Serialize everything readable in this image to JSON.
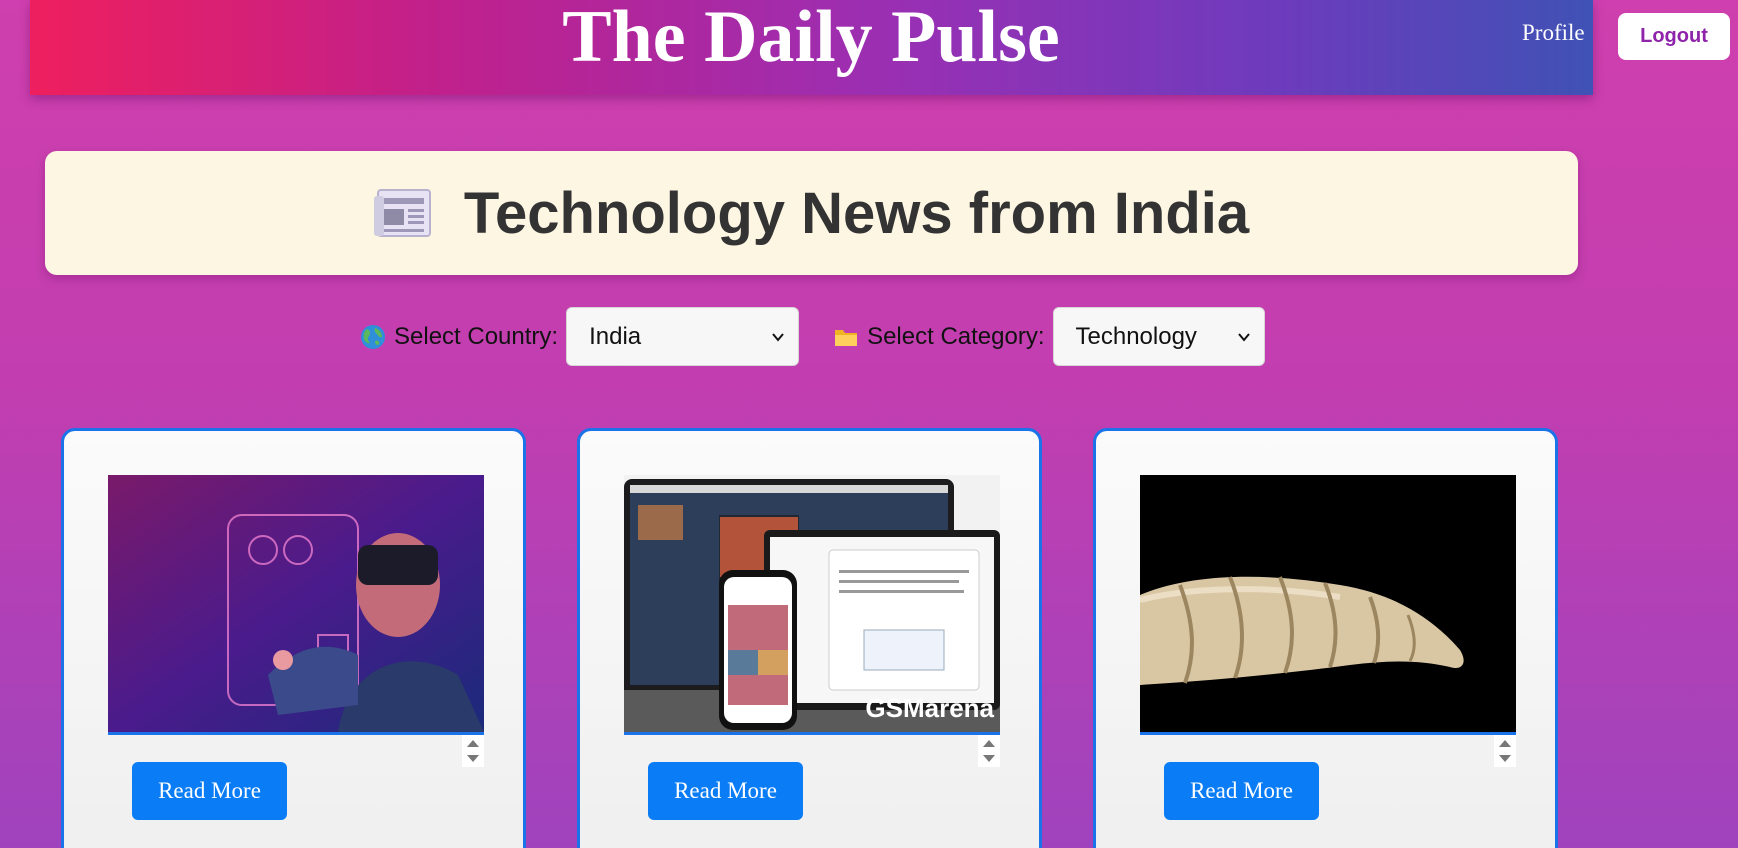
{
  "header": {
    "site_title": "The Daily Pulse",
    "profile_label": "Profile",
    "logout_label": "Logout"
  },
  "headline": {
    "icon": "newspaper-icon",
    "text": "Technology News from India"
  },
  "filters": {
    "country": {
      "icon": "globe-icon",
      "label": "Select Country:",
      "selected": "India"
    },
    "category": {
      "icon": "folder-icon",
      "label": "Select Category:",
      "selected": "Technology"
    }
  },
  "articles": [
    {
      "image": "vr-headset-person-image",
      "button_label": "Read More"
    },
    {
      "image": "apple-devices-screenshot-image",
      "image_watermark": "GSMarena",
      "button_label": "Read More"
    },
    {
      "image": "larva-closeup-image",
      "button_label": "Read More"
    }
  ],
  "colors": {
    "accent_blue": "#0a7cf5",
    "card_border": "#1a73e8",
    "logout_text": "#8e24aa",
    "headline_panel": "#fdf6e3"
  }
}
